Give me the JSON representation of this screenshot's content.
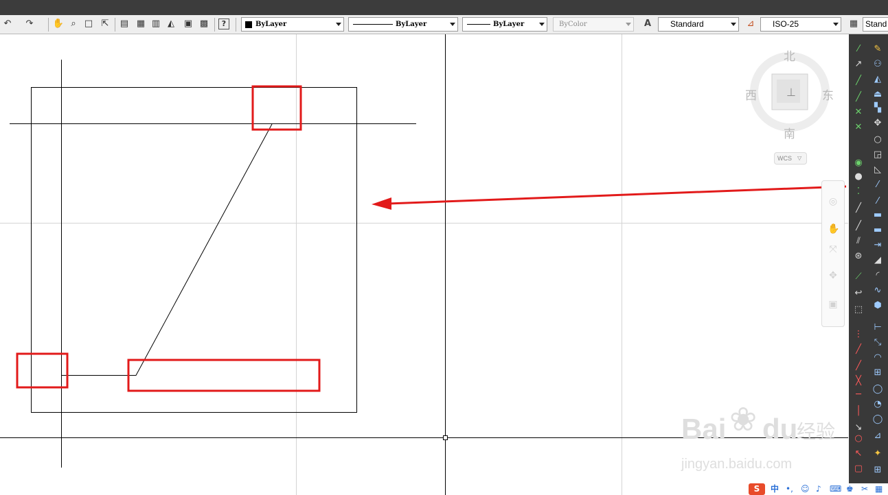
{
  "toolbar": {
    "color_combo": "ByLayer",
    "linetype_combo": "ByLayer",
    "lineweight_combo": "ByLayer",
    "plotstyle_combo": "ByColor",
    "text_style_combo": "Standard",
    "dim_style_combo": "ISO-25",
    "table_style_combo": "Stand",
    "icons": [
      "undo-icon",
      "redo-icon",
      "pan-icon",
      "zoom-realtime-icon",
      "zoom-window-icon",
      "zoom-previous-icon",
      "properties-icon",
      "design-center-icon",
      "tool-palettes-icon",
      "markup-icon",
      "sheet-set-icon",
      "quickcalc-icon",
      "help-icon"
    ]
  },
  "viewcube": {
    "north": "北",
    "south": "南",
    "east": "东",
    "west": "西",
    "wcs_label": "WCS"
  },
  "watermark": {
    "brand_a": "Bai",
    "brand_b": "du",
    "brand_cn": "经验",
    "url": "jingyan.baidu.com"
  },
  "systray": {
    "ime_label": "S",
    "lang_label": "中"
  },
  "colors": {
    "highlight": "#e21a1a",
    "ribbon": "#393939",
    "toolbar": "#eeeeee",
    "titlebar": "#3c3c3c"
  }
}
